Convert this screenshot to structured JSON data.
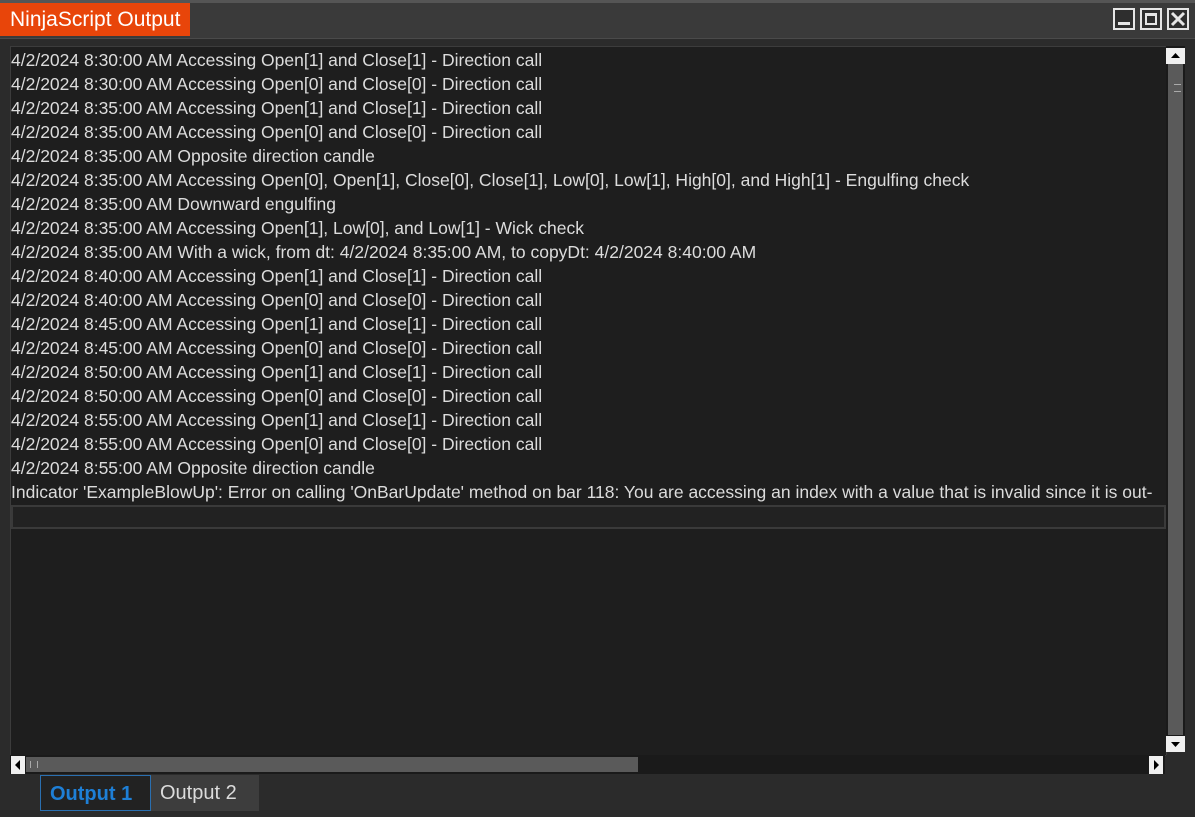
{
  "window": {
    "title": "NinjaScript Output",
    "controls": {
      "minimize_icon": "minimize-icon",
      "maximize_icon": "maximize-icon",
      "close_icon": "close-icon"
    }
  },
  "output": {
    "lines": [
      "4/2/2024 8:30:00 AM Accessing Open[1] and Close[1] - Direction call",
      "4/2/2024 8:30:00 AM Accessing Open[0] and Close[0] - Direction call",
      "4/2/2024 8:35:00 AM Accessing Open[1] and Close[1] - Direction call",
      "4/2/2024 8:35:00 AM Accessing Open[0] and Close[0] - Direction call",
      "4/2/2024 8:35:00 AM Opposite direction candle",
      "4/2/2024 8:35:00 AM Accessing Open[0], Open[1], Close[0], Close[1], Low[0], Low[1], High[0], and High[1] - Engulfing check",
      "4/2/2024 8:35:00 AM Downward engulfing",
      "4/2/2024 8:35:00 AM Accessing Open[1], Low[0], and Low[1] - Wick check",
      "4/2/2024 8:35:00 AM With a wick, from dt: 4/2/2024 8:35:00 AM, to copyDt: 4/2/2024 8:40:00 AM",
      "4/2/2024 8:40:00 AM Accessing Open[1] and Close[1] - Direction call",
      "4/2/2024 8:40:00 AM Accessing Open[0] and Close[0] - Direction call",
      "4/2/2024 8:45:00 AM Accessing Open[1] and Close[1] - Direction call",
      "4/2/2024 8:45:00 AM Accessing Open[0] and Close[0] - Direction call",
      "4/2/2024 8:50:00 AM Accessing Open[1] and Close[1] - Direction call",
      "4/2/2024 8:50:00 AM Accessing Open[0] and Close[0] - Direction call",
      "4/2/2024 8:55:00 AM Accessing Open[1] and Close[1] - Direction call",
      "4/2/2024 8:55:00 AM Accessing Open[0] and Close[0] - Direction call",
      "4/2/2024 8:55:00 AM Opposite direction candle",
      "Indicator 'ExampleBlowUp': Error on calling 'OnBarUpdate' method on bar 118: You are accessing an index with a value that is invalid since it is out-"
    ],
    "input_value": ""
  },
  "tabs": [
    {
      "label": "Output 1",
      "active": true
    },
    {
      "label": "Output 2",
      "active": false
    }
  ],
  "colors": {
    "title_accent": "#e8450a",
    "active_tab_text": "#1e7fd6",
    "background": "#1e1e1e",
    "text": "#dcdcdc"
  }
}
